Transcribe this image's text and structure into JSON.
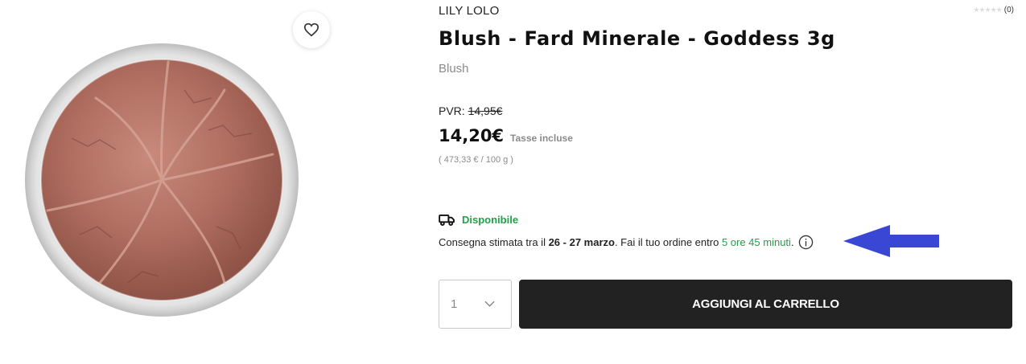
{
  "product": {
    "brand": "LILY LOLO",
    "title": "Blush - Fard Minerale - Goddess 3g",
    "category": "Blush",
    "rating_count": "(0)",
    "rating_value": 0
  },
  "pricing": {
    "pvr_label": "PVR:",
    "pvr_old": "14,95€",
    "price": "14,20€",
    "tax_label": "Tasse incluse",
    "unit_price": "( 473,33 € / 100 g )"
  },
  "availability": {
    "status": "Disponibile",
    "delivery_prefix": "Consegna stimata tra il",
    "delivery_dates": "26 - 27 marzo",
    "delivery_middle": ". Fai il tuo ordine entro",
    "delivery_time": "5 ore 45 minuti",
    "delivery_suffix": "."
  },
  "cart": {
    "quantity": "1",
    "add_label": "AGGIUNGI AL CARRELLO"
  },
  "icons": {
    "wishlist": "heart-icon",
    "truck": "truck-icon",
    "info": "info-icon",
    "chevron": "chevron-down-icon",
    "annotation": "arrow-left-icon"
  },
  "colors": {
    "accent_green": "#22a04a",
    "button_dark": "#222222",
    "annotation_arrow": "#3a47d5"
  }
}
